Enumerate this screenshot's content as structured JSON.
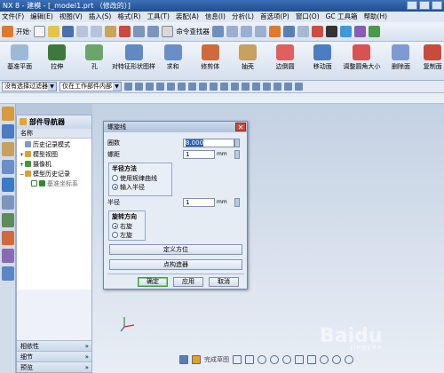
{
  "window": {
    "title": "NX 8 - 建模 - [_model1.prt （修改的）]"
  },
  "menu": [
    "文件(F)",
    "编辑(E)",
    "视图(V)",
    "插入(S)",
    "格式(R)",
    "工具(T)",
    "装配(A)",
    "信息(I)",
    "分析(L)",
    "首选项(P)",
    "窗口(O)",
    "GC 工具箱",
    "帮助(H)"
  ],
  "toolbar1": {
    "start_label": "开始·",
    "cmd_finder_label": "命令查找器"
  },
  "toolbar2": [
    "基准平面",
    "拉伸",
    "孔",
    "对特征形状图样",
    "求和",
    "修剪体",
    "抽壳",
    "边倒圆",
    "移动面",
    "调整圆角大小",
    "删除面",
    "复制面"
  ],
  "filters": {
    "type_filter": "没有选择过滤器",
    "scope_filter": "仅在工作部件内部"
  },
  "navigator": {
    "title": "部件导航器",
    "column": "名称",
    "tree": [
      {
        "label": "历史记录模式",
        "icon_color": "#7a9cc6",
        "indent": 0,
        "exp": ""
      },
      {
        "label": "模型视图",
        "icon_color": "#e0a030",
        "indent": 0,
        "exp": "+"
      },
      {
        "label": "摄像机",
        "icon_color": "#3a9a3a",
        "indent": 0,
        "exp": "+"
      },
      {
        "label": "模型历史记录",
        "icon_color": "#e0a030",
        "indent": 0,
        "exp": "−"
      },
      {
        "label": "基准坐标系",
        "icon_color": "#2f8a2f",
        "indent": 1,
        "exp": ""
      }
    ],
    "sections": [
      "相依性",
      "细节",
      "预览"
    ]
  },
  "dialog": {
    "title": "螺旋线",
    "turns_label": "圈数",
    "turns_value": "8.000",
    "pitch_label": "螺距",
    "pitch_value": "1",
    "unit": "mm",
    "radius_method": {
      "title": "半径方法",
      "options": [
        "使用规律曲线",
        "输入半径"
      ],
      "selected": "输入半径"
    },
    "radius_label": "半径",
    "radius_value": "1",
    "direction": {
      "title": "旋转方向",
      "options": [
        "右旋",
        "左旋"
      ],
      "selected": "右旋"
    },
    "define_orient_label": "定义方位",
    "point_constructor_label": "点构造器",
    "ok_label": "确定",
    "apply_label": "应用",
    "cancel_label": "取消"
  },
  "status": {
    "sketch_label": "完成草图"
  },
  "watermark": {
    "brand": "Baidu",
    "sub": "jingyan"
  }
}
